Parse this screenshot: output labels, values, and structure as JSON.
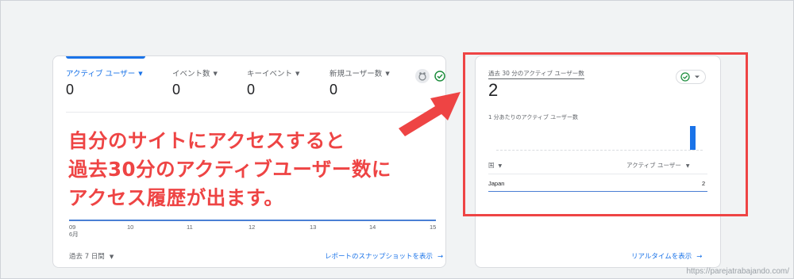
{
  "left_card": {
    "metrics": [
      {
        "label": "アクティブ ユーザー",
        "value": "0",
        "active": true
      },
      {
        "label": "イベント数",
        "value": "0",
        "active": false
      },
      {
        "label": "キーイベント",
        "value": "0",
        "active": false
      },
      {
        "label": "新規ユーザー数",
        "value": "0",
        "active": false
      }
    ],
    "x_ticks": [
      "09",
      "10",
      "11",
      "12",
      "13",
      "14",
      "15"
    ],
    "x_month": "6月",
    "date_range": "過去 7 日間",
    "snapshot_link": "レポートのスナップショットを表示"
  },
  "overlay": {
    "lines": [
      "自分のサイトにアクセスすると",
      "過去30分のアクティブユーザー数に",
      "アクセス履歴が出ます。"
    ],
    "color": "#ee4444"
  },
  "right_card": {
    "title": "過去 30 分のアクティブ ユーザー数",
    "value": "2",
    "subtitle": "1 分あたりのアクティブ ユーザー数",
    "per_minute_counts": [
      0,
      0,
      0,
      0,
      0,
      0,
      0,
      0,
      0,
      0,
      0,
      0,
      0,
      0,
      0,
      0,
      0,
      0,
      0,
      0,
      0,
      0,
      0,
      0,
      0,
      0,
      0,
      0,
      2,
      0
    ],
    "table": {
      "col1": "国",
      "col2": "アクティブ ユーザー",
      "rows": [
        {
          "country": "Japan",
          "users": "2"
        }
      ]
    },
    "realtime_link": "リアルタイムを表示"
  },
  "watermark": "https://parejatrabajando.com/",
  "colors": {
    "accent": "#1a73e8",
    "annotation": "#ee4444",
    "success": "#1e8e3e"
  }
}
